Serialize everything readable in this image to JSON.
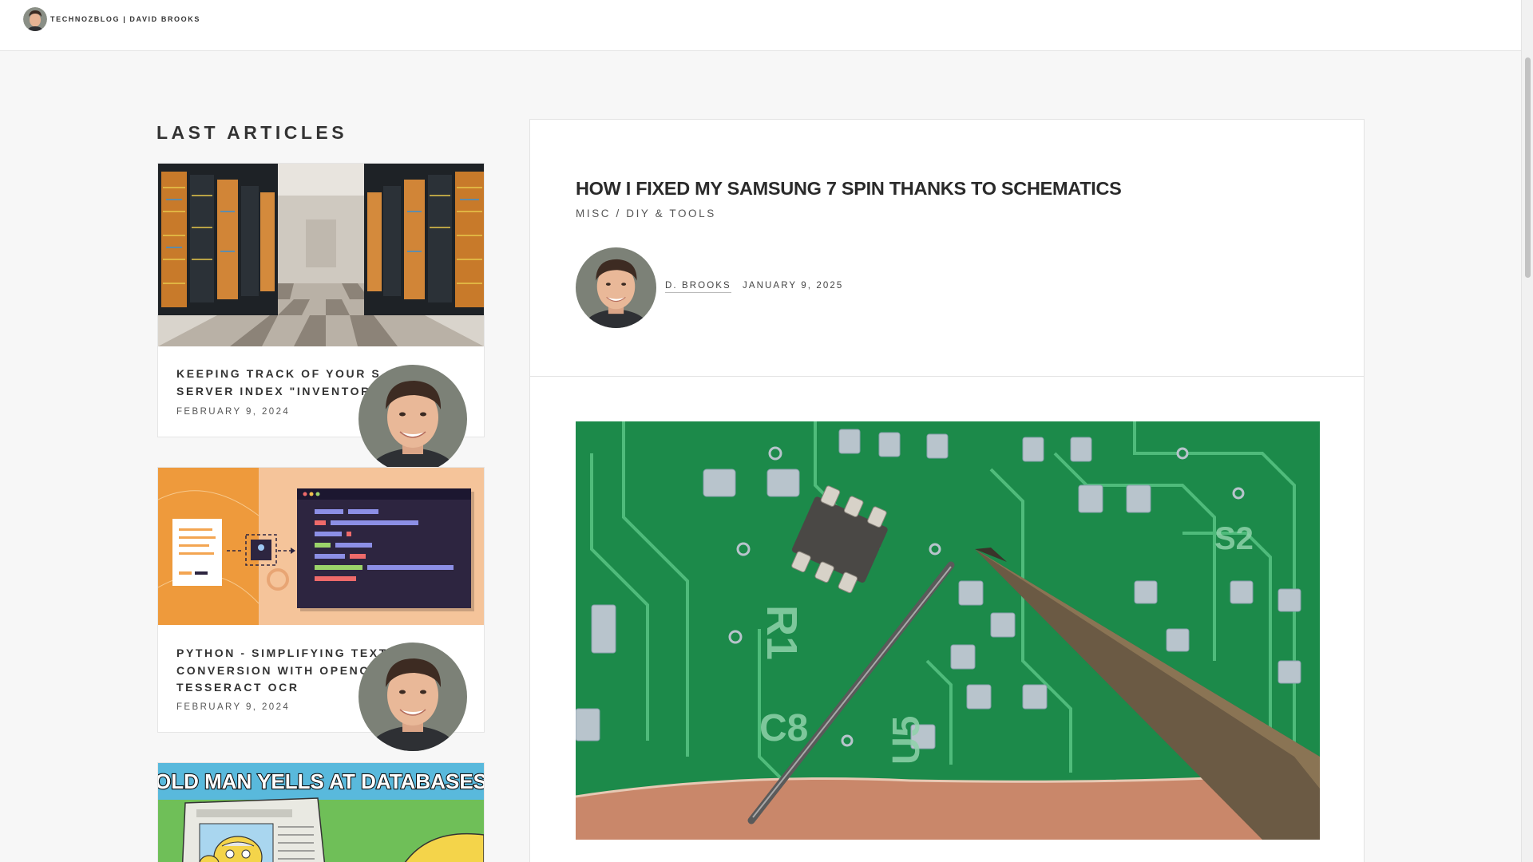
{
  "header": {
    "site_name": "TECHNOZBLOG | DAVID BROOKS"
  },
  "sidebar": {
    "title": "LAST ARTICLES",
    "articles": [
      {
        "title": "KEEPING TRACK OF YOUR SERVER INDEX \"INVENTORY\"",
        "title_visible": "KEEPING TRACK OF YOUR S",
        "title_line2": "SERVER INDEX \"INVENTOR",
        "date": "FEBRUARY 9, 2024"
      },
      {
        "title_line1": "PYTHON - SIMPLIFYING TEXT",
        "title_line2": "CONVERSION WITH OPENC",
        "title_line3": "TESSERACT OCR",
        "date": "FEBRUARY 9, 2024"
      },
      {
        "image_text": "OLD MAN YELLS AT DATABASES"
      }
    ]
  },
  "article": {
    "title": "HOW I FIXED MY SAMSUNG 7 SPIN THANKS TO SCHEMATICS",
    "category_1": "MISC",
    "category_sep": " / ",
    "category_2": "DIY & TOOLS",
    "author": "D. BROOKS",
    "date": "JANUARY 9, 2025"
  },
  "colors": {
    "pcb_green": "#1c8a4a",
    "ocr_orange": "#ee9a3c",
    "meme_banner": "#59b9dc"
  }
}
